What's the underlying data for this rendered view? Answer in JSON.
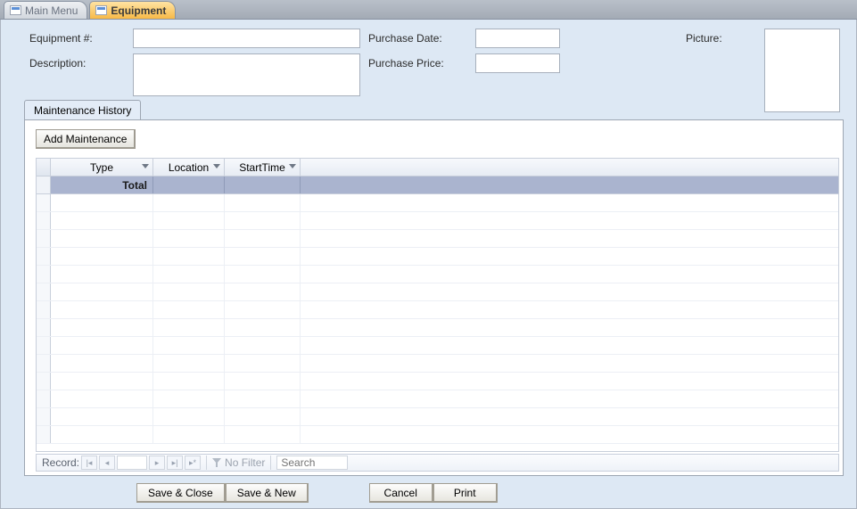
{
  "tabs": {
    "main_menu": "Main Menu",
    "equipment": "Equipment"
  },
  "form": {
    "eqnum_label": "Equipment #:",
    "eqnum_value": "",
    "desc_label": "Description:",
    "desc_value": "",
    "pdate_label": "Purchase Date:",
    "pdate_value": "",
    "pprice_label": "Purchase Price:",
    "pprice_value": "",
    "picture_label": "Picture:"
  },
  "subform": {
    "tab_label": "Maintenance History",
    "add_button": "Add Maintenance",
    "columns": {
      "type": "Type",
      "location": "Location",
      "starttime": "StartTime"
    },
    "total_label": "Total"
  },
  "recordnav": {
    "label": "Record:",
    "current": "",
    "nofilter": "No Filter",
    "search_placeholder": "Search"
  },
  "buttons": {
    "save_close": "Save & Close",
    "save_new": "Save & New",
    "cancel": "Cancel",
    "print": "Print"
  }
}
